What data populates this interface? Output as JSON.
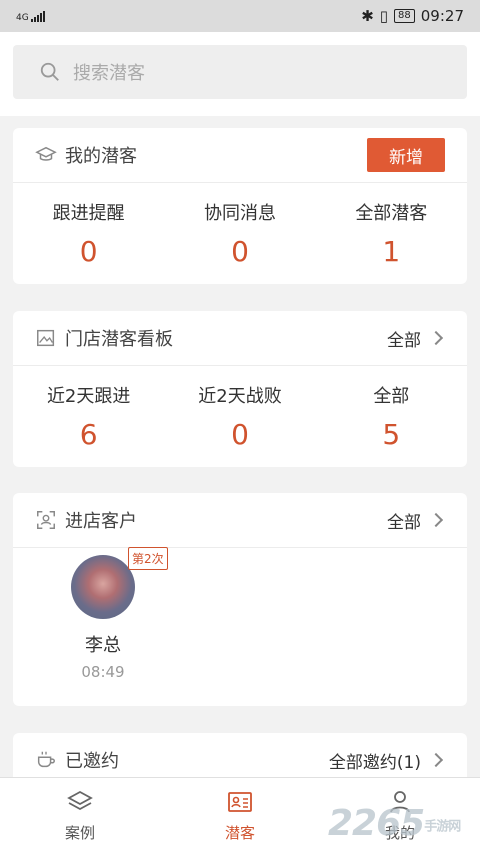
{
  "status_bar": {
    "network": "4G",
    "battery": "88",
    "time": "09:27"
  },
  "search": {
    "placeholder": "搜索潜客"
  },
  "my_leads": {
    "title": "我的潜客",
    "add_label": "新增",
    "stats": [
      {
        "label": "跟进提醒",
        "value": "0"
      },
      {
        "label": "协同消息",
        "value": "0"
      },
      {
        "label": "全部潜客",
        "value": "1"
      }
    ]
  },
  "store_board": {
    "title": "门店潜客看板",
    "more_label": "全部",
    "stats": [
      {
        "label": "近2天跟进",
        "value": "6"
      },
      {
        "label": "近2天战败",
        "value": "0"
      },
      {
        "label": "全部",
        "value": "5"
      }
    ]
  },
  "visitors": {
    "title": "进店客户",
    "more_label": "全部",
    "items": [
      {
        "badge": "第2次",
        "name": "李总",
        "time": "08:49"
      }
    ]
  },
  "invited": {
    "title": "已邀约",
    "more_label": "全部邀约(1)"
  },
  "tabbar": {
    "tabs": [
      {
        "label": "案例",
        "icon": "layers-icon"
      },
      {
        "label": "潜客",
        "icon": "contact-card-icon",
        "active": true
      },
      {
        "label": "我的",
        "icon": "person-icon"
      }
    ]
  },
  "watermark": {
    "text": "2265",
    "sub": "手游网"
  },
  "colors": {
    "accent": "#d0532e",
    "button": "#e05a34"
  }
}
